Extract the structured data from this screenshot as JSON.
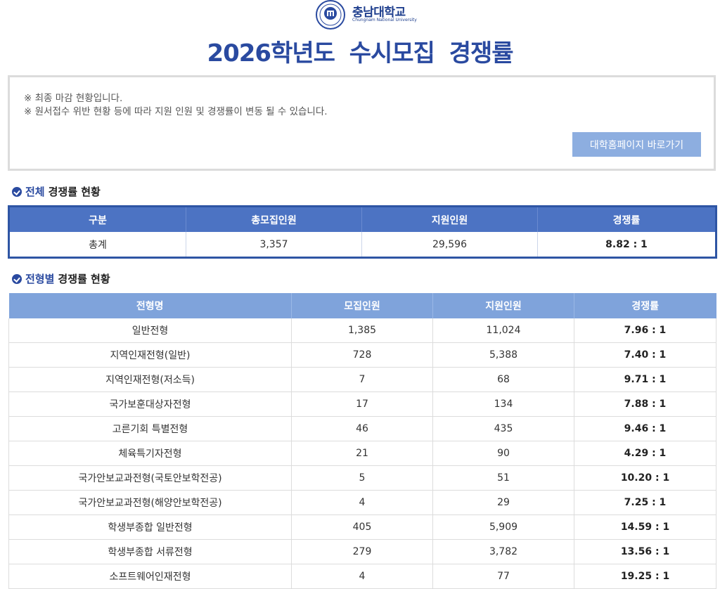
{
  "header": {
    "brand_ko": "충남대학교",
    "brand_en": "Chungnam National University",
    "seal_text": "충남대학교",
    "title": "2026학년도 수시모집 경쟁률"
  },
  "notice": {
    "line1": "※ 최종 마감 현황입니다.",
    "line2": "※ 원서접수 위반 현황 등에 따라 지원 인원 및 경쟁률이 변동 될 수 있습니다.",
    "home_button": "대학홈페이지 바로가기"
  },
  "overall": {
    "title_highlight": "전체",
    "title_rest": "경쟁률 현황",
    "headers": [
      "구분",
      "총모집인원",
      "지원인원",
      "경쟁률"
    ],
    "row": [
      "총계",
      "3,357",
      "29,596",
      "8.82 : 1"
    ]
  },
  "by_type": {
    "title_highlight": "전형별",
    "title_rest": "경쟁률 현황",
    "headers": [
      "전형명",
      "모집인원",
      "지원인원",
      "경쟁률"
    ],
    "rows": [
      [
        "일반전형",
        "1,385",
        "11,024",
        "7.96 : 1"
      ],
      [
        "지역인재전형(일반)",
        "728",
        "5,388",
        "7.40 : 1"
      ],
      [
        "지역인재전형(저소득)",
        "7",
        "68",
        "9.71 : 1"
      ],
      [
        "국가보훈대상자전형",
        "17",
        "134",
        "7.88 : 1"
      ],
      [
        "고른기회 특별전형",
        "46",
        "435",
        "9.46 : 1"
      ],
      [
        "체육특기자전형",
        "21",
        "90",
        "4.29 : 1"
      ],
      [
        "국가안보교과전형(국토안보학전공)",
        "5",
        "51",
        "10.20 : 1"
      ],
      [
        "국가안보교과전형(해양안보학전공)",
        "4",
        "29",
        "7.25 : 1"
      ],
      [
        "학생부종합 일반전형",
        "405",
        "5,909",
        "14.59 : 1"
      ],
      [
        "학생부종합 서류전형",
        "279",
        "3,782",
        "13.56 : 1"
      ],
      [
        "소프트웨어인재전형",
        "4",
        "77",
        "19.25 : 1"
      ]
    ]
  },
  "colors": {
    "brand": "#2a4aa0",
    "overall_header": "#4c73c3",
    "type_header": "#7fa3db",
    "button": "#8daee0"
  }
}
